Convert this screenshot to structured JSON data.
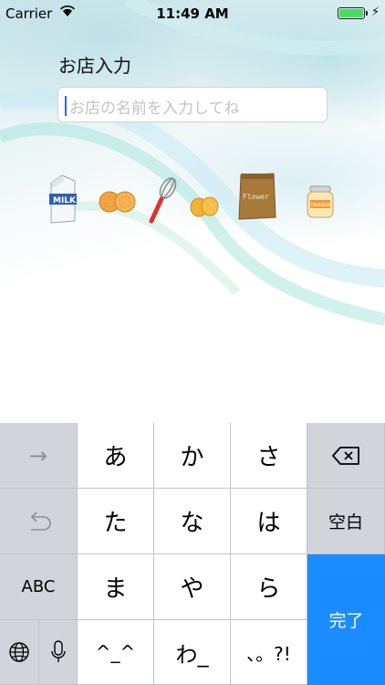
{
  "status_bar": {
    "carrier": "Carrier",
    "time": "11:49 AM",
    "battery_level": 1.0,
    "battery_color": "#4cd964",
    "icons": [
      "wifi-icon",
      "battery-icon",
      "charging-bolt-icon"
    ]
  },
  "form": {
    "label": "お店入力",
    "input_value": "",
    "input_placeholder": "お店の名前を入力してね",
    "caret_color": "#2b6ad4"
  },
  "illustrations": [
    "milk-carton-icon",
    "biscuits-icon",
    "whisk-icon",
    "eggs-icon",
    "flour-bag-icon",
    "orange-jam-jar-icon"
  ],
  "illustration_text": {
    "milk": "MILK",
    "flour": "Flower",
    "jam": "ORANGE"
  },
  "keyboard": {
    "rows": [
      [
        "→",
        "あ",
        "か",
        "さ",
        "delete"
      ],
      [
        "undo",
        "た",
        "な",
        "は",
        "空白"
      ],
      [
        "ABC",
        "ま",
        "や",
        "ら",
        "完了"
      ],
      [
        "globe",
        "mic",
        "^_^",
        "わ_",
        "、。?!"
      ]
    ],
    "keys": {
      "arrow": "→",
      "a": "あ",
      "ka": "か",
      "sa": "さ",
      "ta": "た",
      "na": "な",
      "ha": "は",
      "space": "空白",
      "abc": "ABC",
      "ma": "ま",
      "ya": "や",
      "ra": "ら",
      "done": "完了",
      "emoticon": "^_^",
      "wa": "わ_",
      "punct": "、。?!"
    },
    "done_color": "#1a8cff"
  }
}
